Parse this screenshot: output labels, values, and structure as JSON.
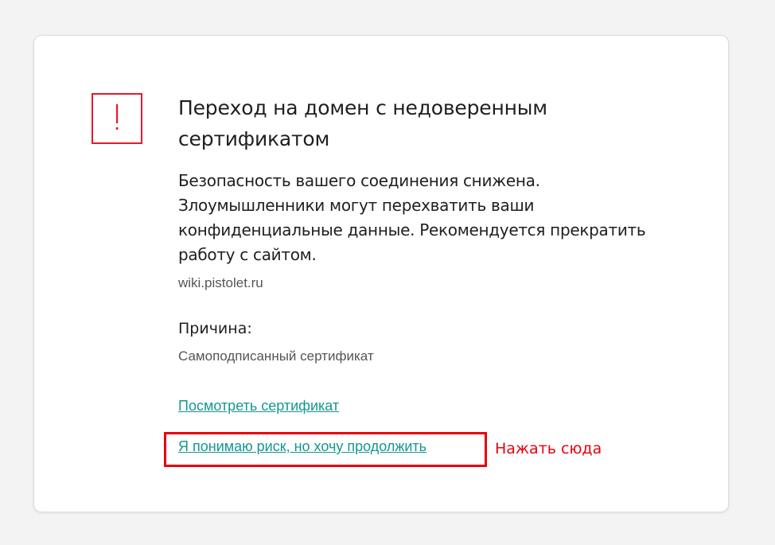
{
  "warning": {
    "icon": "exclamation-icon",
    "icon_color": "#e8192c",
    "title": "Переход на домен с недоверенным сертификатом",
    "message": "Безопасность вашего соединения снижена. Злоумышленники могут перехватить ваши конфиденциальные данные. Рекомендуется прекратить работу с сайтом.",
    "domain": "wiki.pistolet.ru",
    "reason_label": "Причина:",
    "reason_value": "Самоподписанный сертификат"
  },
  "actions": {
    "view_certificate": "Посмотреть сертификат",
    "continue": "Я понимаю риск, но хочу продолжить",
    "link_color": "#159690"
  },
  "annotation": {
    "text": "Нажать сюда",
    "color": "#e8000f"
  }
}
